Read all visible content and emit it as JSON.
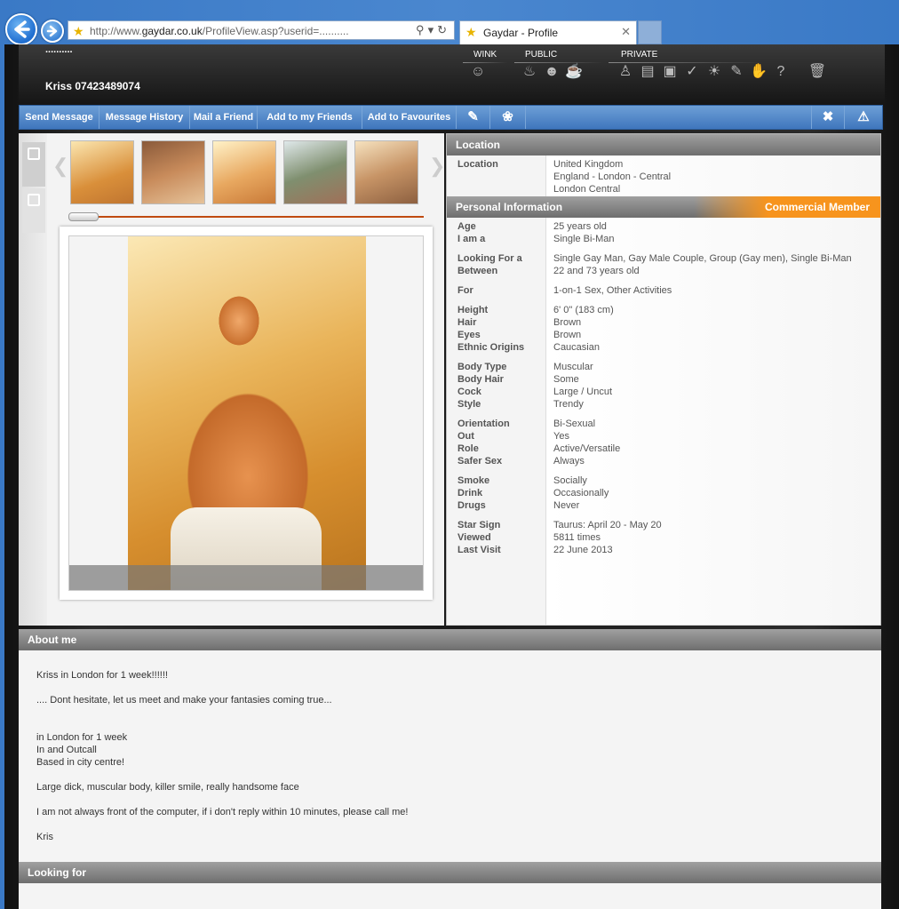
{
  "browser": {
    "url_prefix": "http://www.",
    "url_domain": "gaydar.co.uk",
    "url_suffix": "/ProfileView.asp?userid=..........",
    "tab_title": "Gaydar - Profile"
  },
  "header": {
    "dots": "..........",
    "profile_name": "Kriss 07423489074",
    "groups": {
      "wink": "WINK",
      "public": "PUBLIC",
      "private": "PRIVATE"
    }
  },
  "toolbar": {
    "send_message": "Send Message",
    "message_history": "Message History",
    "mail_friend": "Mail a Friend",
    "add_friends": "Add to my Friends",
    "add_favourites": "Add to Favourites"
  },
  "location": {
    "heading": "Location",
    "label": "Location",
    "values": [
      "United Kingdom",
      "England - London - Central",
      "London Central"
    ]
  },
  "personal": {
    "heading": "Personal Information",
    "member_badge": "Commercial Member",
    "rows": [
      {
        "labels": [
          "Age",
          "I am a"
        ],
        "values": [
          "25 years old",
          "Single Bi-Man"
        ]
      },
      {
        "labels": [
          "Looking For a",
          "Between"
        ],
        "values": [
          "Single Gay Man, Gay Male Couple, Group (Gay men), Single Bi-Man",
          "22 and 73 years old"
        ]
      },
      {
        "labels": [
          "For"
        ],
        "values": [
          "1-on-1 Sex, Other Activities"
        ]
      },
      {
        "labels": [
          "Height",
          "Hair",
          "Eyes",
          "Ethnic Origins"
        ],
        "values": [
          "6' 0\" (183 cm)",
          "Brown",
          "Brown",
          "Caucasian"
        ]
      },
      {
        "labels": [
          "Body Type",
          "Body Hair",
          "Cock",
          "Style"
        ],
        "values": [
          "Muscular",
          "Some",
          "Large / Uncut",
          "Trendy"
        ]
      },
      {
        "labels": [
          "Orientation",
          "Out",
          "Role",
          "Safer Sex"
        ],
        "values": [
          "Bi-Sexual",
          "Yes",
          "Active/Versatile",
          "Always"
        ]
      },
      {
        "labels": [
          "Smoke",
          "Drink",
          "Drugs"
        ],
        "values": [
          "Socially",
          "Occasionally",
          "Never"
        ]
      },
      {
        "labels": [
          "Star Sign",
          "Viewed",
          "Last Visit"
        ],
        "values": [
          "Taurus: April 20 - May 20",
          "5811 times",
          "22 June 2013"
        ]
      }
    ]
  },
  "about": {
    "heading": "About me",
    "lines": [
      "Kriss in London for 1 week!!!!!!",
      "",
      ".... Dont hesitate, let us meet and make your fantasies coming true...",
      "",
      "",
      "in London for 1 week",
      "In and Outcall",
      "Based in city centre!",
      "",
      "Large dick, muscular body, killer smile, really handsome face",
      "",
      "I am not always front of the computer, if i don't reply within 10 minutes, please call me!",
      "",
      "Kris"
    ]
  },
  "looking_for": {
    "heading": "Looking for"
  }
}
